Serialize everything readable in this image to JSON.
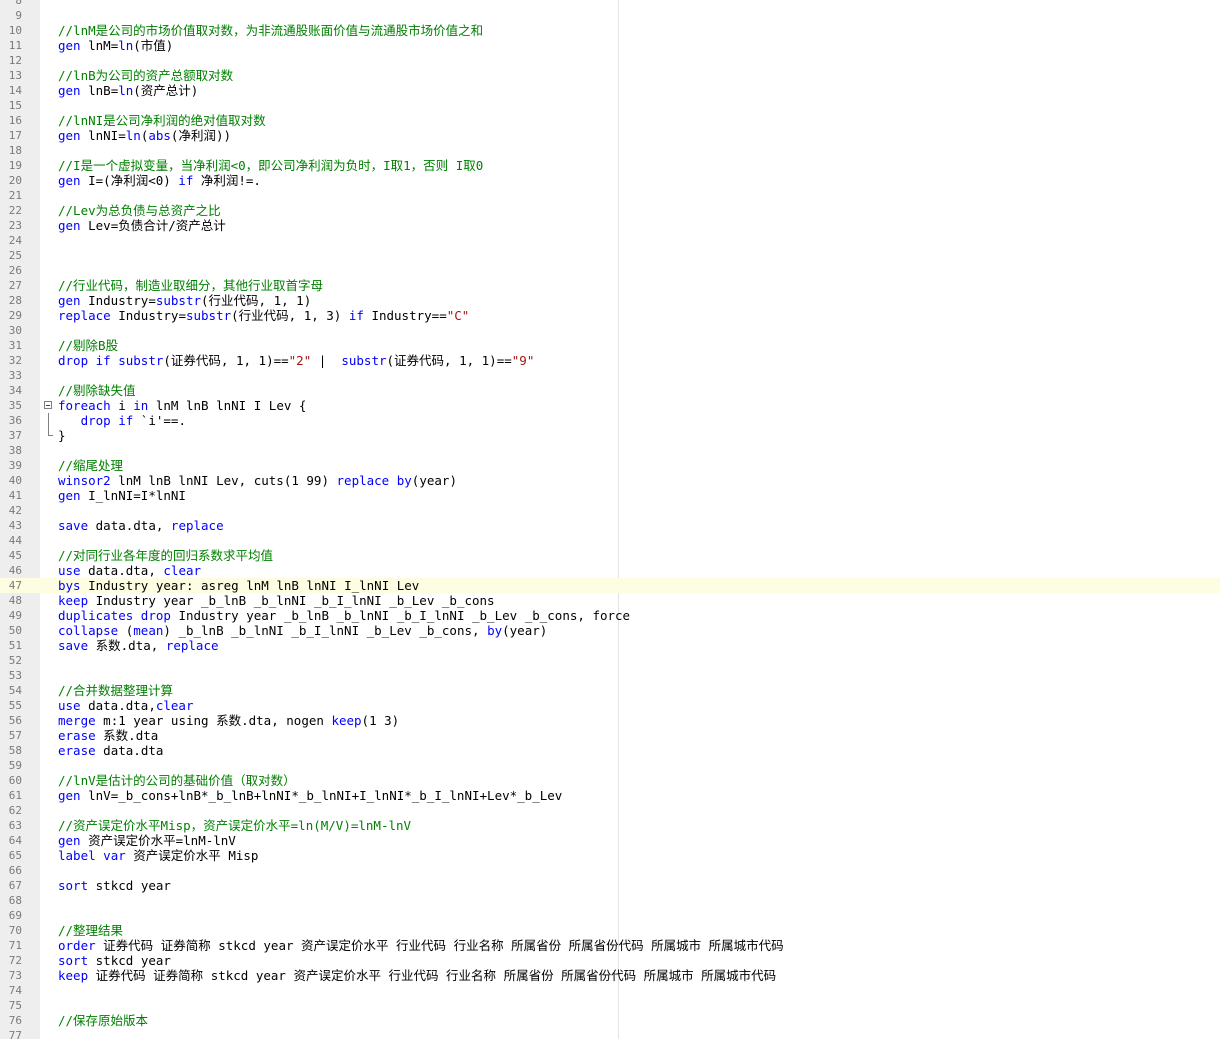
{
  "editor": {
    "lines": [
      {
        "n": "8",
        "t": ""
      },
      {
        "n": "9",
        "t": ""
      },
      {
        "n": "10",
        "t": "//lnM是公司的市场价值取对数，为非流通股账面价值与流通股市场价值之和",
        "c": true
      },
      {
        "n": "11",
        "t": "gen lnM=ln(市值)"
      },
      {
        "n": "12",
        "t": ""
      },
      {
        "n": "13",
        "t": "//lnB为公司的资产总额取对数",
        "c": true
      },
      {
        "n": "14",
        "t": "gen lnB=ln(资产总计)"
      },
      {
        "n": "15",
        "t": ""
      },
      {
        "n": "16",
        "t": "//lnNI是公司净利润的绝对值取对数",
        "c": true
      },
      {
        "n": "17",
        "t": "gen lnNI=ln(abs(净利润))"
      },
      {
        "n": "18",
        "t": ""
      },
      {
        "n": "19",
        "t": "//I是一个虚拟变量，当净利润<0，即公司净利润为负时，I取1，否则 I取0",
        "c": true
      },
      {
        "n": "20",
        "t": "gen I=(净利润<0) if 净利润!=."
      },
      {
        "n": "21",
        "t": ""
      },
      {
        "n": "22",
        "t": "//Lev为总负债与总资产之比",
        "c": true
      },
      {
        "n": "23",
        "t": "gen Lev=负债合计/资产总计"
      },
      {
        "n": "24",
        "t": ""
      },
      {
        "n": "25",
        "t": ""
      },
      {
        "n": "26",
        "t": ""
      },
      {
        "n": "27",
        "t": "//行业代码，制造业取细分，其他行业取首字母",
        "c": true
      },
      {
        "n": "28",
        "t": "gen Industry=substr(行业代码, 1, 1)"
      },
      {
        "n": "29",
        "t": "replace Industry=substr(行业代码, 1, 3) if Industry==\"C\""
      },
      {
        "n": "30",
        "t": ""
      },
      {
        "n": "31",
        "t": "//剔除B股",
        "c": true
      },
      {
        "n": "32",
        "t": "drop if substr(证券代码, 1, 1)==\"2\" |  substr(证券代码, 1, 1)==\"9\""
      },
      {
        "n": "33",
        "t": ""
      },
      {
        "n": "34",
        "t": "//剔除缺失值",
        "c": true
      },
      {
        "n": "35",
        "t": "foreach i in lnM lnB lnNI I Lev {",
        "fold": "start"
      },
      {
        "n": "36",
        "t": "   drop if `i'==.",
        "fold": "mid"
      },
      {
        "n": "37",
        "t": "}",
        "fold": "end"
      },
      {
        "n": "38",
        "t": ""
      },
      {
        "n": "39",
        "t": "//缩尾处理",
        "c": true
      },
      {
        "n": "40",
        "t": "winsor2 lnM lnB lnNI Lev, cuts(1 99) replace by(year)"
      },
      {
        "n": "41",
        "t": "gen I_lnNI=I*lnNI"
      },
      {
        "n": "42",
        "t": ""
      },
      {
        "n": "43",
        "t": "save data.dta, replace"
      },
      {
        "n": "44",
        "t": ""
      },
      {
        "n": "45",
        "t": "//对同行业各年度的回归系数求平均值",
        "c": true
      },
      {
        "n": "46",
        "t": "use data.dta, clear"
      },
      {
        "n": "47",
        "t": "bys Industry year: asreg lnM lnB lnNI I_lnNI Lev",
        "hl": true
      },
      {
        "n": "48",
        "t": "keep Industry year _b_lnB _b_lnNI _b_I_lnNI _b_Lev _b_cons"
      },
      {
        "n": "49",
        "t": "duplicates drop Industry year _b_lnB _b_lnNI _b_I_lnNI _b_Lev _b_cons, force"
      },
      {
        "n": "50",
        "t": "collapse (mean) _b_lnB _b_lnNI _b_I_lnNI _b_Lev _b_cons, by(year)"
      },
      {
        "n": "51",
        "t": "save 系数.dta, replace"
      },
      {
        "n": "52",
        "t": ""
      },
      {
        "n": "53",
        "t": ""
      },
      {
        "n": "54",
        "t": "//合并数据整理计算",
        "c": true
      },
      {
        "n": "55",
        "t": "use data.dta,clear"
      },
      {
        "n": "56",
        "t": "merge m:1 year using 系数.dta, nogen keep(1 3)"
      },
      {
        "n": "57",
        "t": "erase 系数.dta"
      },
      {
        "n": "58",
        "t": "erase data.dta"
      },
      {
        "n": "59",
        "t": ""
      },
      {
        "n": "60",
        "t": "//lnV是估计的公司的基础价值（取对数）",
        "c": true
      },
      {
        "n": "61",
        "t": "gen lnV=_b_cons+lnB*_b_lnB+lnNI*_b_lnNI+I_lnNI*_b_I_lnNI+Lev*_b_Lev"
      },
      {
        "n": "62",
        "t": ""
      },
      {
        "n": "63",
        "t": "//资产误定价水平Misp，资产误定价水平=ln(M/V)=lnM-lnV",
        "c": true
      },
      {
        "n": "64",
        "t": "gen 资产误定价水平=lnM-lnV"
      },
      {
        "n": "65",
        "t": "label var 资产误定价水平 Misp"
      },
      {
        "n": "66",
        "t": ""
      },
      {
        "n": "67",
        "t": "sort stkcd year"
      },
      {
        "n": "68",
        "t": ""
      },
      {
        "n": "69",
        "t": ""
      },
      {
        "n": "70",
        "t": "//整理结果",
        "c": true
      },
      {
        "n": "71",
        "t": "order 证券代码 证券简称 stkcd year 资产误定价水平 行业代码 行业名称 所属省份 所属省份代码 所属城市 所属城市代码"
      },
      {
        "n": "72",
        "t": "sort stkcd year"
      },
      {
        "n": "73",
        "t": "keep 证券代码 证券简称 stkcd year 资产误定价水平 行业代码 行业名称 所属省份 所属省份代码 所属城市 所属城市代码"
      },
      {
        "n": "74",
        "t": ""
      },
      {
        "n": "75",
        "t": ""
      },
      {
        "n": "76",
        "t": "//保存原始版本",
        "c": true
      },
      {
        "n": "77",
        "t": ""
      }
    ],
    "keywords": [
      "gen",
      "replace",
      "drop",
      "foreach",
      "in",
      "if",
      "save",
      "use",
      "clear",
      "keep",
      "duplicates",
      "collapse",
      "merge",
      "erase",
      "label",
      "var",
      "order",
      "sort",
      "winsor2",
      "substr",
      "abs",
      "ln",
      "by",
      "bys",
      "mean"
    ],
    "colors": {
      "comment": "#008000",
      "keyword": "#0000ff",
      "string": "#a31515",
      "line_highlight": "#fdfde2",
      "gutter": "#eeeeee"
    }
  }
}
